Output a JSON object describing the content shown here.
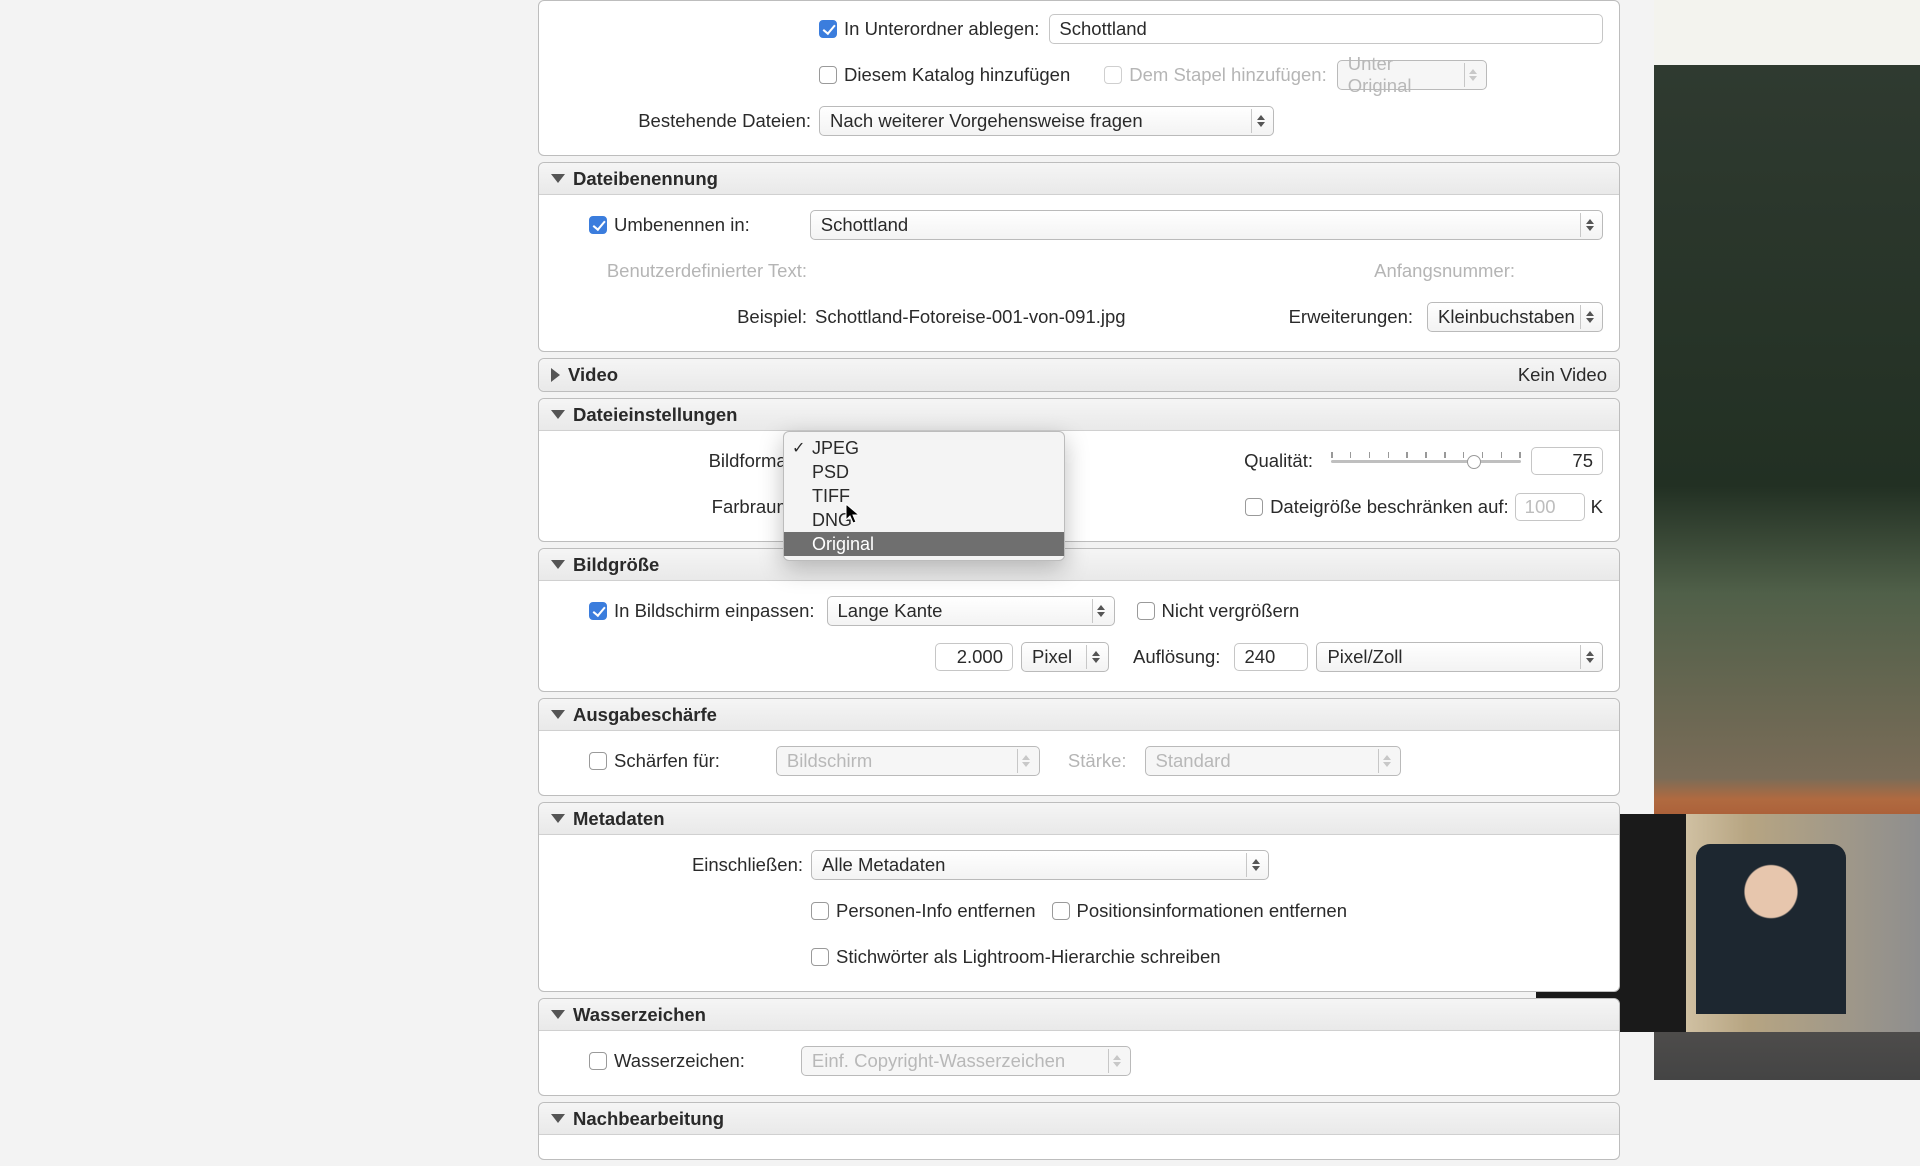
{
  "top": {
    "subfolder_label": "In Unterordner ablegen:",
    "subfolder_value": "Schottland",
    "add_catalog_label": "Diesem Katalog hinzufügen",
    "add_stack_label": "Dem Stapel hinzufügen:",
    "stack_select": "Unter Original",
    "existing_label": "Bestehende Dateien:",
    "existing_value": "Nach weiterer Vorgehensweise fragen"
  },
  "naming": {
    "title": "Dateibenennung",
    "rename_label": "Umbenennen in:",
    "rename_value": "Schottland",
    "custom_text_label": "Benutzerdefinierter Text:",
    "start_num_label": "Anfangsnummer:",
    "example_label": "Beispiel:",
    "example_value": "Schottland-Fotoreise-001-von-091.jpg",
    "ext_label": "Erweiterungen:",
    "ext_value": "Kleinbuchstaben"
  },
  "video": {
    "title": "Video",
    "status": "Kein Video"
  },
  "filesettings": {
    "title": "Dateieinstellungen",
    "format_label": "Bildformat:",
    "colorspace_label": "Farbraum:",
    "quality_label": "Qualität:",
    "quality_value": "75",
    "limit_label": "Dateigröße beschränken auf:",
    "limit_placeholder": "100",
    "limit_unit": "K",
    "dropdown": {
      "options": [
        "JPEG",
        "PSD",
        "TIFF",
        "DNG",
        "Original"
      ],
      "checked_index": 0,
      "hover_index": 4
    }
  },
  "imagesize": {
    "title": "Bildgröße",
    "fit_label": "In Bildschirm einpassen:",
    "fit_value": "Lange Kante",
    "no_enlarge": "Nicht vergrößern",
    "size_value": "2.000",
    "size_unit": "Pixel",
    "res_label": "Auflösung:",
    "res_value": "240",
    "res_unit": "Pixel/Zoll"
  },
  "sharpen": {
    "title": "Ausgabeschärfe",
    "for_label": "Schärfen für:",
    "for_value": "Bildschirm",
    "amount_label": "Stärke:",
    "amount_value": "Standard"
  },
  "metadata": {
    "title": "Metadaten",
    "include_label": "Einschließen:",
    "include_value": "Alle Metadaten",
    "remove_person": "Personen-Info entfernen",
    "remove_location": "Positionsinformationen entfernen",
    "keywords_hierarchy": "Stichwörter als Lightroom-Hierarchie schreiben"
  },
  "watermark": {
    "title": "Wasserzeichen",
    "label": "Wasserzeichen:",
    "value": "Einf. Copyright-Wasserzeichen"
  },
  "post": {
    "title": "Nachbearbeitung"
  }
}
